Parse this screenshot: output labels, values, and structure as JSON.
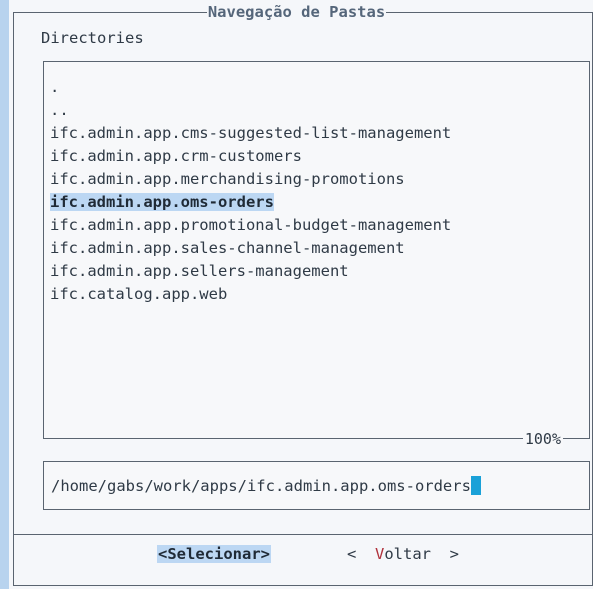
{
  "dialog": {
    "title": "Navegação de Pastas",
    "directories_label": "Directories",
    "items": [
      ".",
      "..",
      "ifc.admin.app.cms-suggested-list-management",
      "ifc.admin.app.crm-customers",
      "ifc.admin.app.merchandising-promotions",
      "ifc.admin.app.oms-orders",
      "ifc.admin.app.promotional-budget-management",
      "ifc.admin.app.sales-channel-management",
      "ifc.admin.app.sellers-management",
      "ifc.catalog.app.web"
    ],
    "selected_index": 5,
    "scroll_percent": "100%",
    "path_value": "/home/gabs/work/apps/ifc.admin.app.oms-orders"
  },
  "buttons": {
    "select_label": "<Selecionar>",
    "back_prefix": "<  ",
    "back_hotkey": "V",
    "back_rest": "oltar",
    "back_suffix": "  >"
  },
  "colors": {
    "background": "#b8d3ee",
    "panel": "#f5f7fa",
    "selection": "#bcd7f3",
    "cursor": "#1aa1d8",
    "hotkey": "#b0323c"
  }
}
